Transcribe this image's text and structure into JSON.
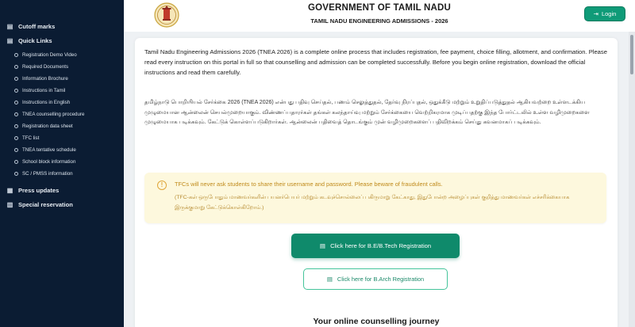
{
  "sidebar": {
    "top_item": "Cutoff marks",
    "quick_links_label": "Quick Links",
    "quick_links": [
      "Registration Demo Video",
      "Required Documents",
      "Information Brochure",
      "Instructions in Tamil",
      "Instructions in English",
      "TNEA counselling procedure",
      "Registration data sheet",
      "TFC list",
      "TNEA tentative schedule",
      "School block information",
      "SC / PMSS information"
    ],
    "press_updates": "Press updates",
    "special_reservation": "Special reservation"
  },
  "header": {
    "title": "GOVERNMENT OF TAMIL NADU",
    "subtitle": "TAMIL NADU ENGINEERING ADMISSIONS - 2026",
    "login_label": "Login"
  },
  "content": {
    "intro_en": "Tamil Nadu Engineering Admissions 2026 (TNEA 2026) is a complete online process that includes registration, fee payment, choice filling, allotment, and confirmation. Please read every instruction on this portal in full so that counselling and admission can be completed successfully. Before you begin online registration, download the official instructions and read them carefully.",
    "intro_ta": "தமிழ்நாடு பொறியியல் சேர்க்கை 2026 (TNEA 2026) என்பது பதிவு செய்தல், பணம் செலுத்துதல், தேர்வு நிரப்புதல், ஒதுக்கீடு மற்றும் உறுதிப்படுத்துதல் ஆகியவற்றை உள்ளடக்கிய முழுமையான ஆன்லைன் செயல்முறையாகும். விண்ணப்பதாரர்கள் தங்கள் கலந்தாய்வு மற்றும் சேர்க்கையை வெற்றிகரமாக முடிப்பதற்கு இந்த போர்ட்டலில் உள்ள வழிமுறைகளை முழுமையாக படிக்கவும். கேட்டுக் கொள்ளப்படுகிறார்கள். ஆன்லைன் பதிவைத் தொடங்கும் முன் வழிமுறைகளைப் பதிவிறக்கம் செய்து கவனமாகப் படிக்கவும்.",
    "warning_en": "TFCs will never ask students to share their username and password. Please beware of fraudulent calls.",
    "warning_ta": "(TFC-கள் ஒருபோதும் மாணவர்களின் பயனர்பெயர் மற்றும் கடவுச்சொல்லைப் பகிருமாறு கேட்காது, இதுபோன்ற அழைப்புகள் குறித்து மாணவர்கள் எச்சரிக்கையாக இருக்குமாறு கேட்டுக்கொள்கிறோம்.)",
    "be_btech_button": "Click here for B.E/B.Tech Registration",
    "barch_button": "Click here for B.Arch Registration",
    "journey_title": "Your online counselling journey"
  },
  "colors": {
    "sidebar_bg": "#0b1c33",
    "accent_green": "#0f8a6b",
    "warning_bg": "#fdf8dd",
    "warning_text": "#c08a1a"
  }
}
